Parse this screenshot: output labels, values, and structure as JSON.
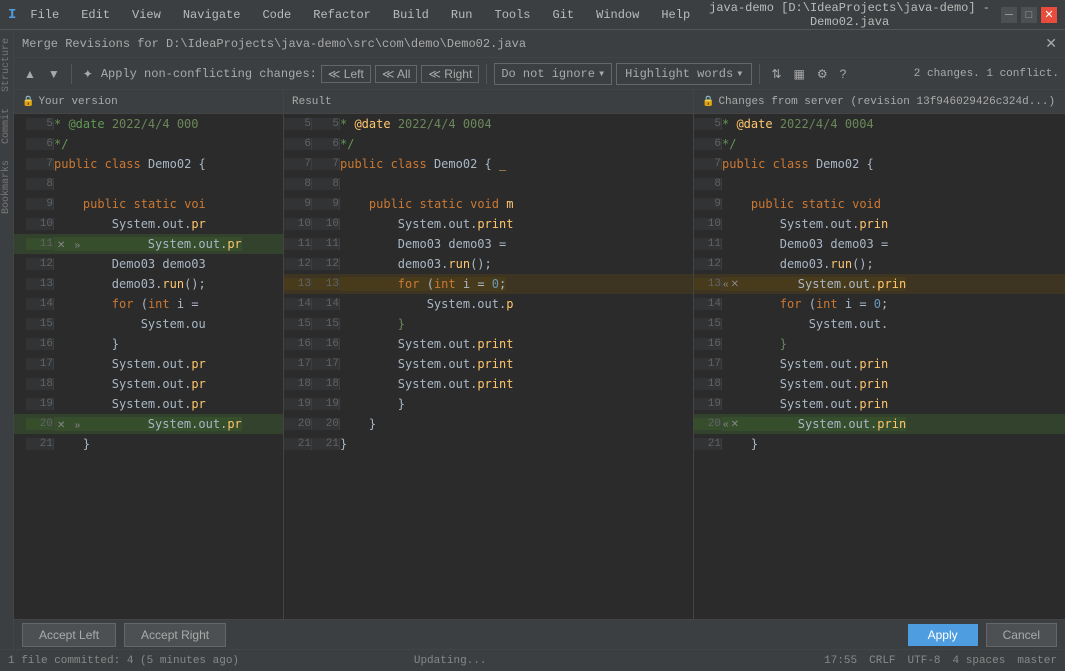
{
  "window": {
    "title": "java-demo [D:\\IdeaProjects\\java-demo] - Demo02.java",
    "menu_items": [
      "File",
      "Edit",
      "View",
      "Navigate",
      "Code",
      "Refactor",
      "Build",
      "Run",
      "Tools",
      "Git",
      "Window",
      "Help"
    ]
  },
  "merge": {
    "title": "Merge Revisions for D:\\IdeaProjects\\java-demo\\src\\com\\demo\\Demo02.java",
    "toolbar": {
      "apply_non_conflicting": "Apply non-conflicting changes:",
      "left_label": "Left",
      "all_label": "All",
      "right_label": "Right",
      "dropdown_ignore": "Do not ignore",
      "highlight_words": "Highlight words",
      "changes_info": "2 changes. 1 conflict."
    },
    "panels": {
      "left": {
        "title": "Your version"
      },
      "center": {
        "title": "Result"
      },
      "right": {
        "title": "Changes from server (revision 13f946029426c324d...)"
      }
    }
  },
  "buttons": {
    "accept_left": "Accept Left",
    "accept_right": "Accept Right",
    "apply": "Apply",
    "cancel": "Cancel"
  },
  "status_bar": {
    "left": "1 file committed: 4 (5 minutes ago)",
    "center": "Updating...",
    "time": "17:55",
    "encoding": "CRLF",
    "charset": "UTF-8",
    "indent": "4 spaces",
    "branch": "master"
  },
  "code": {
    "left_lines": [
      {
        "n": 5,
        "text": "* @date 2022/4/4  000",
        "bg": ""
      },
      {
        "n": 6,
        "text": "*/",
        "bg": ""
      },
      {
        "n": 7,
        "text": "public class Demo02 {",
        "bg": ""
      },
      {
        "n": 8,
        "text": "",
        "bg": ""
      },
      {
        "n": 9,
        "text": "    public static voi",
        "bg": ""
      },
      {
        "n": 10,
        "text": "        System.out.pr",
        "bg": ""
      },
      {
        "n": 11,
        "text": "        System.out.pr",
        "bg": "green"
      },
      {
        "n": 12,
        "text": "        Demo03 demo03",
        "bg": ""
      },
      {
        "n": 13,
        "text": "        demo03.run();",
        "bg": ""
      },
      {
        "n": 14,
        "text": "        for (int i =",
        "bg": ""
      },
      {
        "n": 15,
        "text": "            System.ou",
        "bg": ""
      },
      {
        "n": 16,
        "text": "        }",
        "bg": ""
      },
      {
        "n": 17,
        "text": "        System.out.pr",
        "bg": ""
      },
      {
        "n": 18,
        "text": "        System.out.pr",
        "bg": ""
      },
      {
        "n": 19,
        "text": "        System.out.pr",
        "bg": ""
      },
      {
        "n": 20,
        "text": "        System.out.pr",
        "bg": "green"
      },
      {
        "n": 21,
        "text": "    }",
        "bg": ""
      }
    ],
    "center_lines": [
      {
        "n1": 5,
        "n2": 5,
        "text": "* @date 2022/4/4  0004",
        "bg": ""
      },
      {
        "n1": 6,
        "n2": 6,
        "text": "*/",
        "bg": ""
      },
      {
        "n1": 7,
        "n2": 7,
        "text": "public class Demo02 {",
        "bg": ""
      },
      {
        "n1": 8,
        "n2": 8,
        "text": "",
        "bg": ""
      },
      {
        "n1": 9,
        "n2": 9,
        "text": "    public static void m",
        "bg": ""
      },
      {
        "n1": 10,
        "n2": 10,
        "text": "        System.out.print",
        "bg": ""
      },
      {
        "n1": 11,
        "n2": 11,
        "text": "        Demo03 demo03 =",
        "bg": ""
      },
      {
        "n1": 12,
        "n2": 12,
        "text": "        demo03.run();",
        "bg": ""
      },
      {
        "n1": 13,
        "n2": 13,
        "text": "        for (int i = 0;",
        "bg": "conflict"
      },
      {
        "n1": 14,
        "n2": 14,
        "text": "            System.out.p",
        "bg": ""
      },
      {
        "n1": 15,
        "n2": 15,
        "text": "        }",
        "bg": ""
      },
      {
        "n1": 16,
        "n2": 16,
        "text": "        System.out.print",
        "bg": ""
      },
      {
        "n1": 17,
        "n2": 17,
        "text": "        System.out.print",
        "bg": ""
      },
      {
        "n1": 18,
        "n2": 18,
        "text": "        System.out.print",
        "bg": ""
      },
      {
        "n1": 19,
        "n2": 19,
        "text": "        }",
        "bg": ""
      },
      {
        "n1": 20,
        "n2": 20,
        "text": "    }",
        "bg": ""
      },
      {
        "n1": 21,
        "n2": 21,
        "text": "}",
        "bg": ""
      }
    ],
    "right_lines": [
      {
        "n": 5,
        "text": "* @date 2022/4/4  0004",
        "bg": ""
      },
      {
        "n": 6,
        "text": "*/",
        "bg": ""
      },
      {
        "n": 7,
        "text": "public class Demo02 {",
        "bg": ""
      },
      {
        "n": 8,
        "text": "",
        "bg": ""
      },
      {
        "n": 9,
        "text": "    public static void",
        "bg": ""
      },
      {
        "n": 10,
        "text": "        System.out.prin",
        "bg": ""
      },
      {
        "n": 11,
        "text": "        Demo03 demo03 =",
        "bg": ""
      },
      {
        "n": 12,
        "text": "        demo03.run();",
        "bg": ""
      },
      {
        "n": 13,
        "text": "        System.out.prin",
        "bg": "conflict"
      },
      {
        "n": 14,
        "text": "        for (int i = 0;",
        "bg": ""
      },
      {
        "n": 15,
        "text": "            System.out.",
        "bg": ""
      },
      {
        "n": 16,
        "text": "        }",
        "bg": ""
      },
      {
        "n": 17,
        "text": "        System.out.prin",
        "bg": ""
      },
      {
        "n": 18,
        "text": "        System.out.prin",
        "bg": ""
      },
      {
        "n": 19,
        "text": "        System.out.prin",
        "bg": ""
      },
      {
        "n": 20,
        "text": "        System.out.prin",
        "bg": "green"
      },
      {
        "n": 21,
        "text": "    }",
        "bg": ""
      }
    ]
  }
}
